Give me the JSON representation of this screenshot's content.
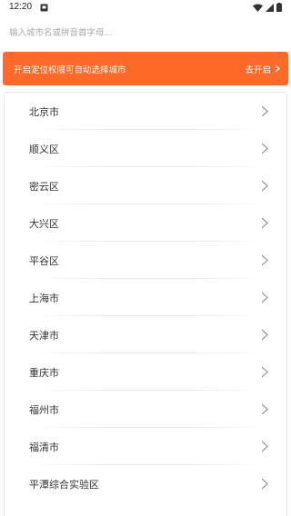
{
  "status_bar": {
    "time": "12:20"
  },
  "search": {
    "placeholder": "输入城市名或拼音首字母..."
  },
  "location_banner": {
    "message": "开启定位权限可自动选择城市",
    "action_label": "去开启",
    "background_color": "#ff6a2b"
  },
  "city_list": {
    "items": [
      {
        "label": "北京市"
      },
      {
        "label": "顺义区"
      },
      {
        "label": "密云区"
      },
      {
        "label": "大兴区"
      },
      {
        "label": "平谷区"
      },
      {
        "label": "上海市"
      },
      {
        "label": "天津市"
      },
      {
        "label": "重庆市"
      },
      {
        "label": "福州市"
      },
      {
        "label": "福清市"
      },
      {
        "label": "平潭综合实验区"
      }
    ]
  }
}
